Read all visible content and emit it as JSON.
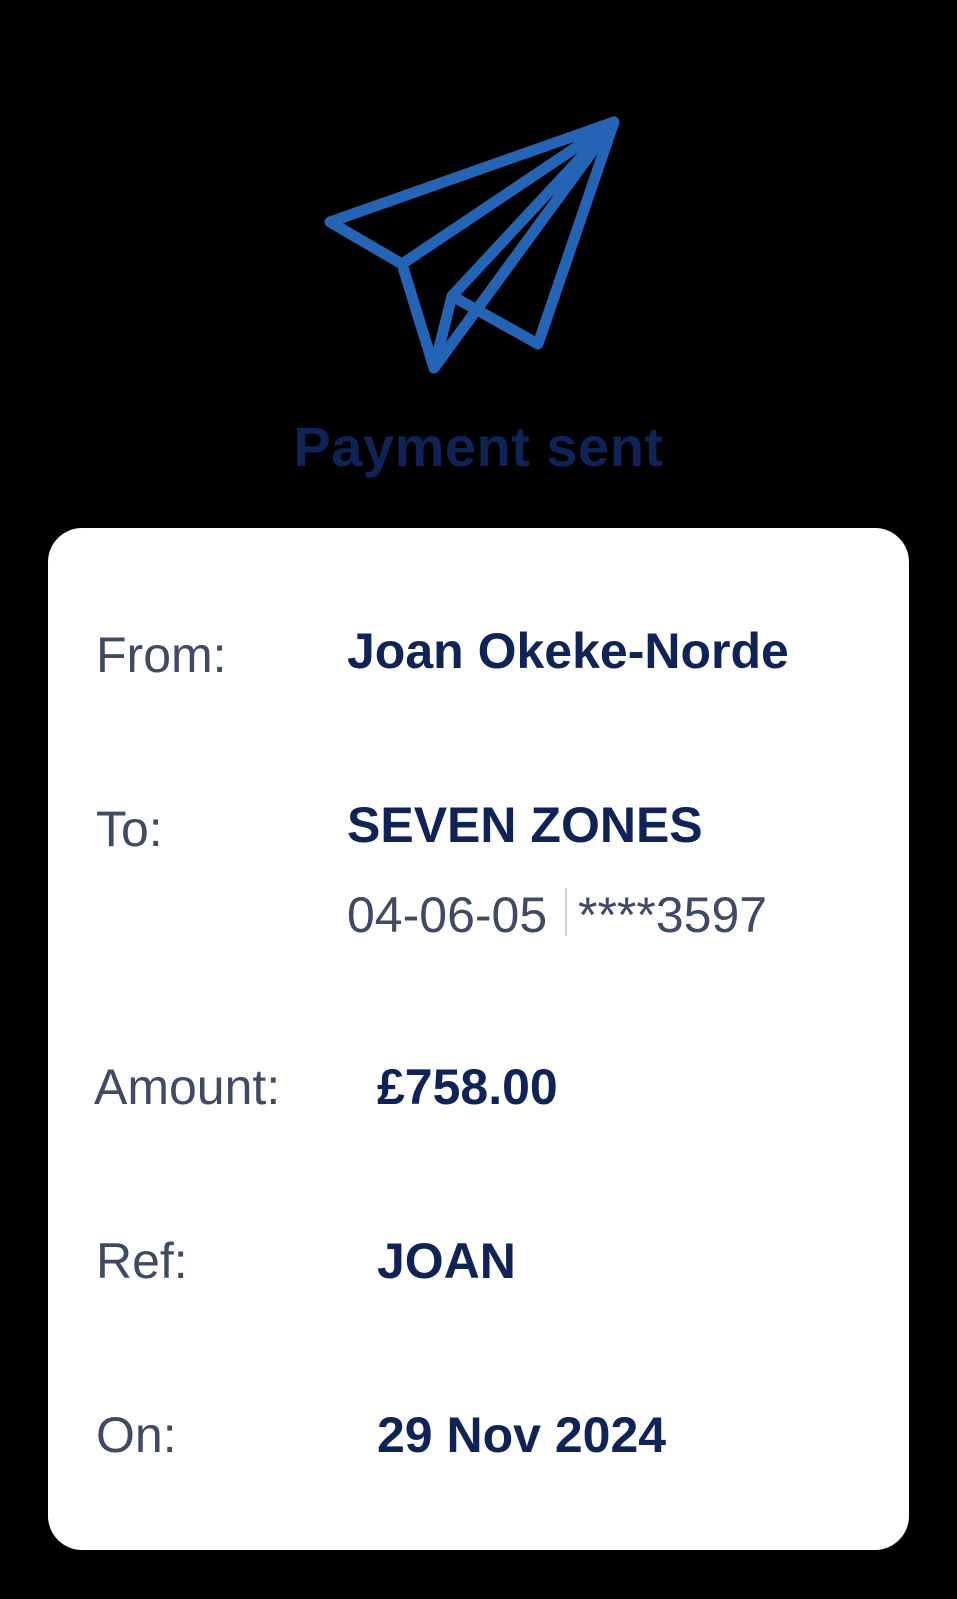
{
  "status": {
    "icon": "paper-plane-icon",
    "title": "Payment sent"
  },
  "details": {
    "from_label": "From:",
    "from_value": "Joan Okeke-Norde",
    "to_label": "To:",
    "to_name": "SEVEN ZONES",
    "to_sort_code": "04-06-05",
    "to_account": "****3597",
    "amount_label": "Amount:",
    "amount_value": "£758.00",
    "ref_label": "Ref:",
    "ref_value": "JOAN",
    "on_label": "On:",
    "on_value": "29 Nov 2024"
  },
  "colors": {
    "background": "#000000",
    "card": "#ffffff",
    "accent_blue": "#2563b5",
    "navy_text": "#0f2356",
    "label_text": "#3f4a63"
  }
}
